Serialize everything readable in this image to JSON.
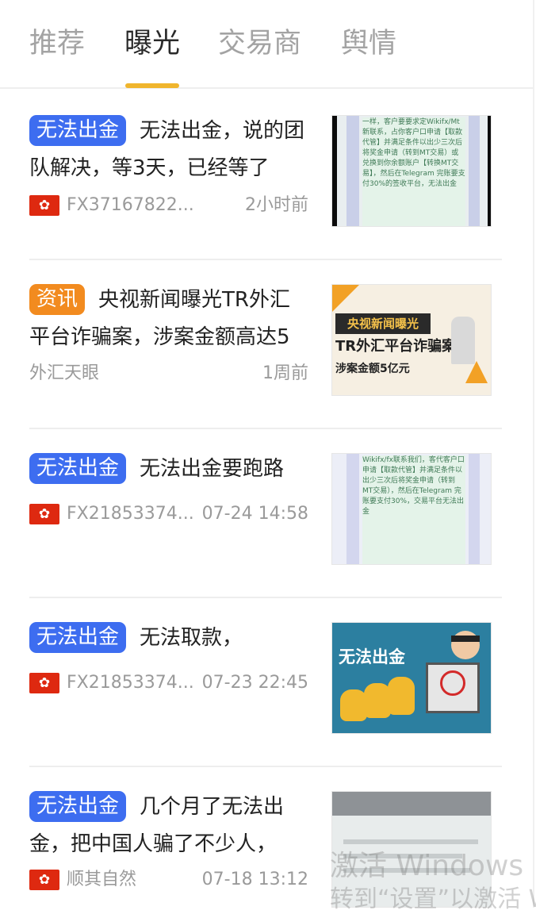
{
  "tabs": [
    {
      "label": "推荐",
      "active": false
    },
    {
      "label": "曝光",
      "active": true
    },
    {
      "label": "交易商",
      "active": false
    },
    {
      "label": "舆情",
      "active": false
    }
  ],
  "colors": {
    "accent": "#f0b52d",
    "exposure_badge": "#3d6df0",
    "news_badge": "#f28b1f"
  },
  "items": [
    {
      "badge": "无法出金",
      "badge_type": "exposure",
      "title": "无法出金，说的团队解决，等3天，已经等了",
      "flag": "hk-flag-icon",
      "user": "FX37167822...",
      "time": "2小时前",
      "thumb_text": "一样，客户要要求定Wikifx/Mt新联系，占你客户口申请【取款代管】并满足条件以出少三次后将奖金申请（转到MT交易）或兑换到你余额账户【转换MT交易】，然后在Telegram 完账要支付30%的签收平台，无法出金"
    },
    {
      "badge": "资讯",
      "badge_type": "news",
      "title": "央视新闻曝光TR外汇平台诈骗案，涉案金额高达5",
      "flag": null,
      "user": "外汇天眼",
      "time": "1周前",
      "thumb_heading": "央视新闻曝光",
      "thumb_main": "TR外汇平台诈骗案",
      "thumb_sub": "涉案金额5亿元"
    },
    {
      "badge": "无法出金",
      "badge_type": "exposure",
      "title": "无法出金要跑路",
      "flag": "hk-flag-icon",
      "user": "FX21853374...",
      "time": "07-24 14:58",
      "thumb_text": "Wikifx/fx联系我们，客代客户口申请【取款代管】并满足条件以出少三次后将奖金申请（转到MT交易），然后在Telegram 完账要支付30%，交易平台无法出金"
    },
    {
      "badge": "无法出金",
      "badge_type": "exposure",
      "title": "无法取款，",
      "flag": "hk-flag-icon",
      "user": "FX21853374...",
      "time": "07-23 22:45",
      "thumb_heading": "无法出金"
    },
    {
      "badge": "无法出金",
      "badge_type": "exposure",
      "title": "几个月了无法出金，把中国人骗了不少人，",
      "flag": "hk-flag-icon",
      "user": "顺其自然",
      "time": "07-18 13:12"
    }
  ],
  "watermark": {
    "line1": "激活 Windows",
    "line2": "转到“设置”以激活 W"
  }
}
